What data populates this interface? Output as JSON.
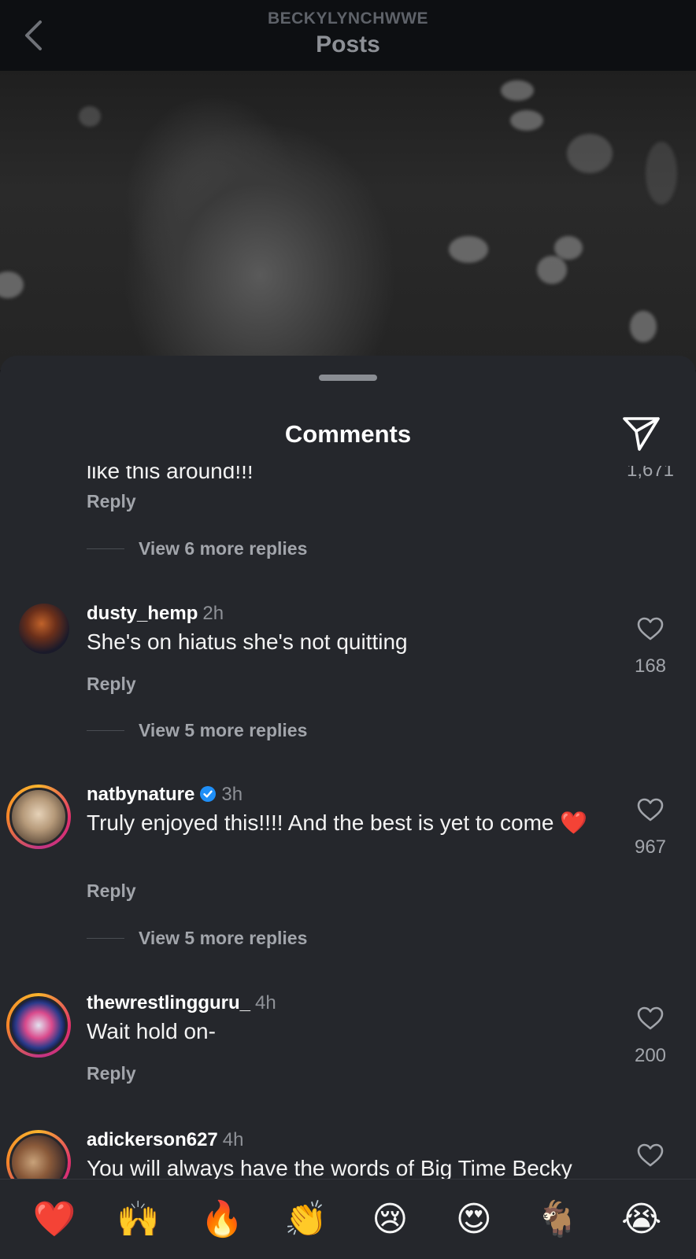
{
  "header": {
    "username": "BECKYLYNCHWWE",
    "title": "Posts"
  },
  "sheet": {
    "title": "Comments"
  },
  "partial_comment": {
    "text": "like this around!!!",
    "reply_label": "Reply",
    "likes": "1,671",
    "view_more": "View 6 more replies"
  },
  "comments": [
    {
      "username": "dusty_hemp",
      "time": "2h",
      "text": "She's on hiatus she's not quitting",
      "reply_label": "Reply",
      "likes": "168",
      "view_more": "View 5 more replies",
      "verified": false
    },
    {
      "username": "natbynature",
      "time": "3h",
      "text": "Truly enjoyed this!!!! And the best is yet to come ❤️",
      "reply_label": "Reply",
      "likes": "967",
      "view_more": "View 5 more replies",
      "verified": true
    },
    {
      "username": "thewrestlingguru_",
      "time": "4h",
      "text": "Wait hold on-",
      "reply_label": "Reply",
      "likes": "200",
      "verified": false
    },
    {
      "username": "adickerson627",
      "time": "4h",
      "text": "You will always have the words of Big Time Becky",
      "verified": false
    }
  ],
  "emoji_bar": [
    "❤️",
    "🙌",
    "🔥",
    "👏",
    "😢",
    "😍",
    "🐐",
    "😭"
  ],
  "colors": {
    "sheet_bg": "#25272c",
    "verified_blue": "#1f8ff7",
    "muted_text": "#a2a5ab"
  }
}
